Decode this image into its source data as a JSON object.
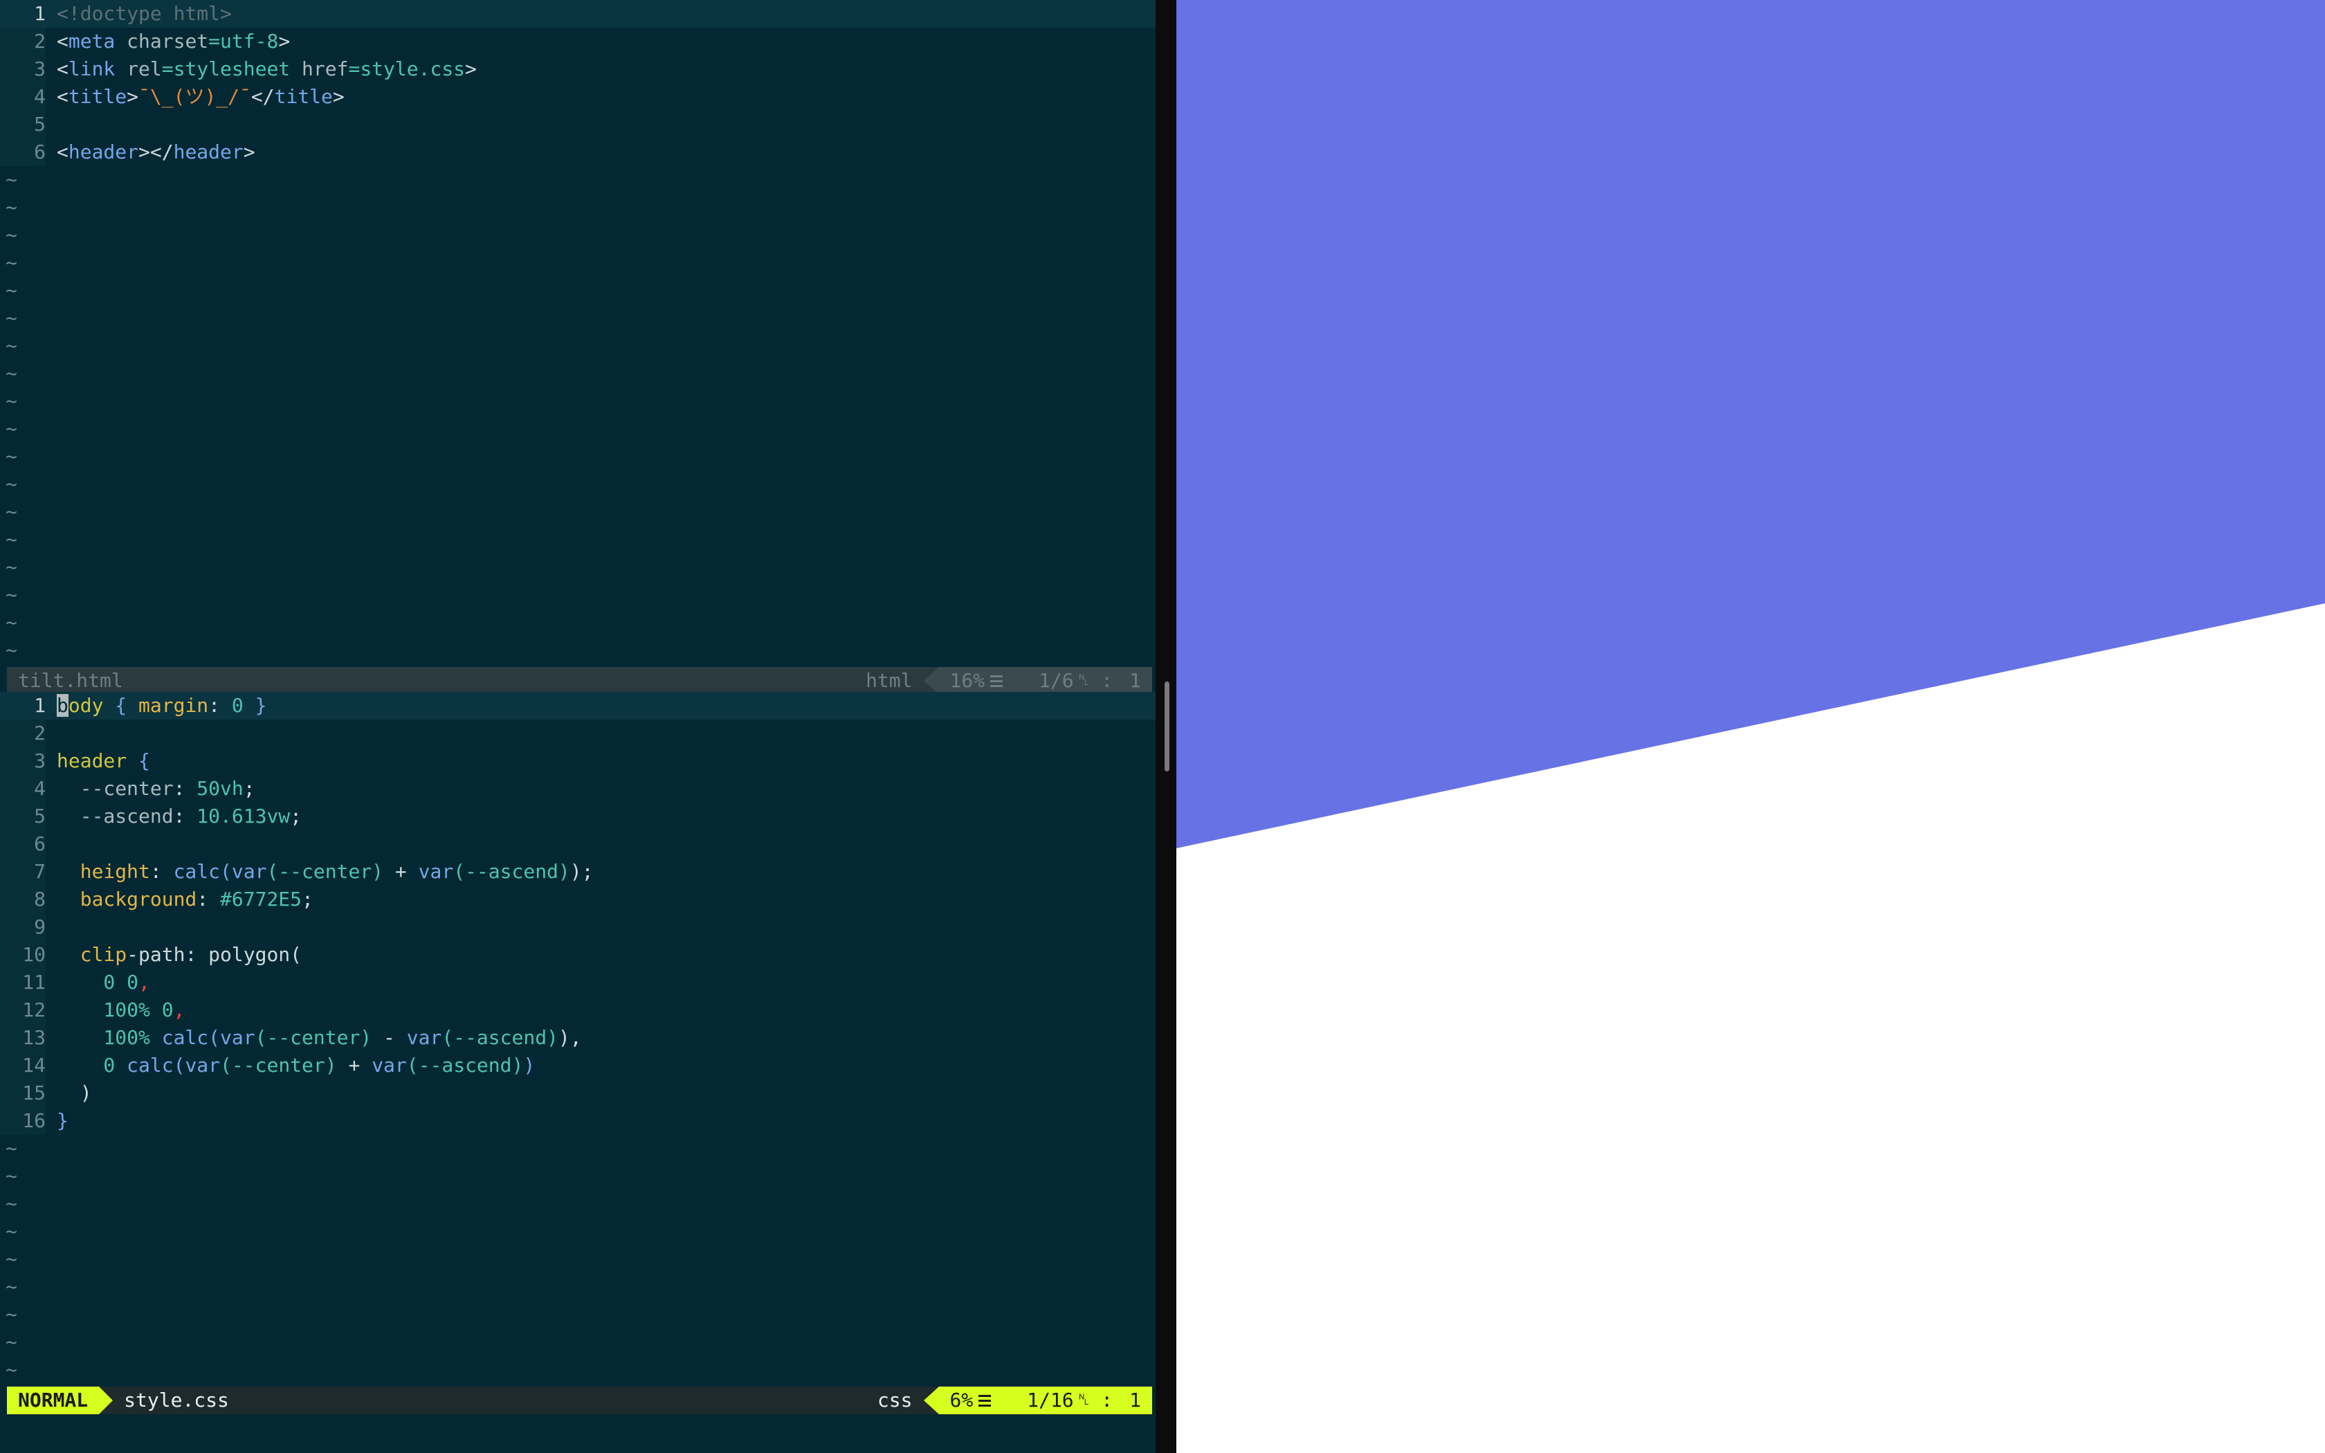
{
  "top_pane": {
    "filename": "tilt.html",
    "filetype": "html",
    "percent": "16%",
    "position": "1/6",
    "column": "1",
    "lines": [
      {
        "num": "1",
        "tokens": [
          {
            "t": "<!doctype html>",
            "c": "t-gray"
          }
        ]
      },
      {
        "num": "2",
        "tokens": [
          {
            "t": "<",
            "c": "t-op"
          },
          {
            "t": "meta",
            "c": "t-blue"
          },
          {
            "t": " charset",
            "c": "t-attr"
          },
          {
            "t": "=utf-8",
            "c": "t-val"
          },
          {
            "t": ">",
            "c": "t-op"
          }
        ]
      },
      {
        "num": "3",
        "tokens": [
          {
            "t": "<",
            "c": "t-op"
          },
          {
            "t": "link",
            "c": "t-blue"
          },
          {
            "t": " rel",
            "c": "t-attr"
          },
          {
            "t": "=stylesheet",
            "c": "t-val"
          },
          {
            "t": " href",
            "c": "t-attr"
          },
          {
            "t": "=style.css",
            "c": "t-val"
          },
          {
            "t": ">",
            "c": "t-op"
          }
        ]
      },
      {
        "num": "4",
        "tokens": [
          {
            "t": "<",
            "c": "t-op"
          },
          {
            "t": "title",
            "c": "t-blue"
          },
          {
            "t": ">",
            "c": "t-op"
          },
          {
            "t": "¯\\_(ツ)_/¯",
            "c": "t-orange"
          },
          {
            "t": "</",
            "c": "t-op"
          },
          {
            "t": "title",
            "c": "t-blue"
          },
          {
            "t": ">",
            "c": "t-op"
          }
        ]
      },
      {
        "num": "5",
        "tokens": []
      },
      {
        "num": "6",
        "tokens": [
          {
            "t": "<",
            "c": "t-op"
          },
          {
            "t": "header",
            "c": "t-blue"
          },
          {
            "t": "></",
            "c": "t-op"
          },
          {
            "t": "header",
            "c": "t-blue"
          },
          {
            "t": ">",
            "c": "t-op"
          }
        ]
      }
    ],
    "tilde_count": 18
  },
  "bottom_pane": {
    "filename": "style.css",
    "filetype": "css",
    "mode": "NORMAL",
    "percent": "6%",
    "position": "1/16",
    "column": "1",
    "lines": [
      {
        "num": "1",
        "tokens": [
          {
            "t": "b",
            "c": "cursor-block"
          },
          {
            "t": "ody",
            "c": "t-yellow"
          },
          {
            "t": " { ",
            "c": "t-blue"
          },
          {
            "t": "margin",
            "c": "t-prop"
          },
          {
            "t": ": ",
            "c": "t-op"
          },
          {
            "t": "0",
            "c": "t-num"
          },
          {
            "t": " }",
            "c": "t-blue"
          }
        ]
      },
      {
        "num": "2",
        "tokens": []
      },
      {
        "num": "3",
        "tokens": [
          {
            "t": "header",
            "c": "t-yellow"
          },
          {
            "t": " {",
            "c": "t-blue"
          }
        ]
      },
      {
        "num": "4",
        "tokens": [
          {
            "t": "  --center",
            "c": "t-attr"
          },
          {
            "t": ": ",
            "c": "t-op"
          },
          {
            "t": "50vh",
            "c": "t-num"
          },
          {
            "t": ";",
            "c": "t-op"
          }
        ]
      },
      {
        "num": "5",
        "tokens": [
          {
            "t": "  --ascend",
            "c": "t-attr"
          },
          {
            "t": ": ",
            "c": "t-op"
          },
          {
            "t": "10.613vw",
            "c": "t-num"
          },
          {
            "t": ";",
            "c": "t-op"
          }
        ]
      },
      {
        "num": "6",
        "tokens": []
      },
      {
        "num": "7",
        "tokens": [
          {
            "t": "  height",
            "c": "t-prop"
          },
          {
            "t": ": ",
            "c": "t-op"
          },
          {
            "t": "calc",
            "c": "t-func"
          },
          {
            "t": "(",
            "c": "t-blue"
          },
          {
            "t": "var",
            "c": "t-func"
          },
          {
            "t": "(--center)",
            "c": "t-val"
          },
          {
            "t": " + ",
            "c": "t-op"
          },
          {
            "t": "var",
            "c": "t-func"
          },
          {
            "t": "(--ascend)",
            "c": "t-val"
          },
          {
            "t": ");",
            "c": "t-op"
          }
        ]
      },
      {
        "num": "8",
        "tokens": [
          {
            "t": "  background",
            "c": "t-prop"
          },
          {
            "t": ": ",
            "c": "t-op"
          },
          {
            "t": "#6772E5",
            "c": "t-val"
          },
          {
            "t": ";",
            "c": "t-op"
          }
        ]
      },
      {
        "num": "9",
        "tokens": []
      },
      {
        "num": "10",
        "tokens": [
          {
            "t": "  clip",
            "c": "t-prop"
          },
          {
            "t": "-path: polygon(",
            "c": "t-op"
          }
        ]
      },
      {
        "num": "11",
        "tokens": [
          {
            "t": "    0 0",
            "c": "t-num"
          },
          {
            "t": ",",
            "c": "t-red"
          }
        ]
      },
      {
        "num": "12",
        "tokens": [
          {
            "t": "    100%",
            "c": "t-num"
          },
          {
            "t": " 0",
            "c": "t-val"
          },
          {
            "t": ",",
            "c": "t-red"
          }
        ]
      },
      {
        "num": "13",
        "tokens": [
          {
            "t": "    100%",
            "c": "t-num"
          },
          {
            "t": " calc",
            "c": "t-func"
          },
          {
            "t": "(",
            "c": "t-blue"
          },
          {
            "t": "var",
            "c": "t-func"
          },
          {
            "t": "(--center)",
            "c": "t-val"
          },
          {
            "t": " - ",
            "c": "t-op"
          },
          {
            "t": "var",
            "c": "t-func"
          },
          {
            "t": "(--ascend)",
            "c": "t-val"
          },
          {
            "t": "),",
            "c": "t-op"
          }
        ]
      },
      {
        "num": "14",
        "tokens": [
          {
            "t": "    0",
            "c": "t-num"
          },
          {
            "t": " calc",
            "c": "t-func"
          },
          {
            "t": "(",
            "c": "t-blue"
          },
          {
            "t": "var",
            "c": "t-func"
          },
          {
            "t": "(--center)",
            "c": "t-val"
          },
          {
            "t": " + ",
            "c": "t-op"
          },
          {
            "t": "var",
            "c": "t-func"
          },
          {
            "t": "(--ascend)",
            "c": "t-val"
          },
          {
            "t": ")",
            "c": "t-blue"
          }
        ]
      },
      {
        "num": "15",
        "tokens": [
          {
            "t": "  )",
            "c": "t-op"
          }
        ]
      },
      {
        "num": "16",
        "tokens": [
          {
            "t": "}",
            "c": "t-blue"
          }
        ]
      }
    ],
    "tilde_count": 9
  },
  "colors": {
    "editor_bg": "#032833",
    "accent_lime": "#d7ff1f",
    "header_fill": "#6772E5",
    "preview_bg": "#ffffff"
  },
  "icons": {
    "lines": "lines-icon",
    "line_number": "line-number-icon"
  }
}
